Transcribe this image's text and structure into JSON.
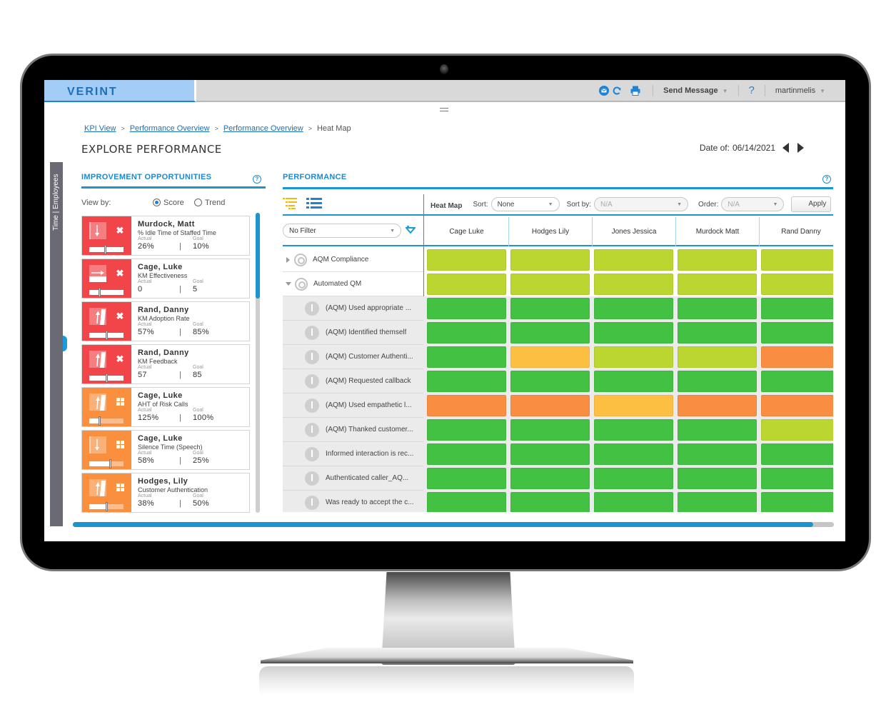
{
  "app": {
    "brand": "VERINT",
    "topbar": {
      "icons": [
        "mail-icon",
        "refresh-icon",
        "print-icon"
      ],
      "send_message": "Send Message",
      "help": "?",
      "username": "martinmelis"
    }
  },
  "breadcrumb": [
    {
      "label": "KPI View",
      "link": true
    },
    {
      "label": "Performance Overview",
      "link": true
    },
    {
      "label": "Performance Overview",
      "link": true
    },
    {
      "label": "Heat Map",
      "link": false
    }
  ],
  "breadcrumb_separator": ">",
  "page_title": "EXPLORE PERFORMANCE",
  "date": {
    "label": "Date of:",
    "value": "06/14/2021"
  },
  "side_tab": "Time | Employees",
  "improvement": {
    "title": "IMPROVEMENT OPPORTUNITIES",
    "view_by_label": "View by:",
    "options": [
      {
        "label": "Score",
        "selected": true
      },
      {
        "label": "Trend",
        "selected": false
      }
    ],
    "actual_label": "Actual",
    "goal_label": "Goal",
    "cards": [
      {
        "name": "Murdock, Matt",
        "kpi": "% Idle Time of Staffed Time",
        "actual": "26%",
        "goal": "10%",
        "status": "red",
        "trend": "down",
        "gauge": 0.45
      },
      {
        "name": "Cage, Luke",
        "kpi": "KM Effectiveness",
        "actual": "0",
        "goal": "5",
        "status": "red",
        "trend": "flat",
        "gauge": 0.3
      },
      {
        "name": "Rand, Danny",
        "kpi": "KM Adoption Rate",
        "actual": "57%",
        "goal": "85%",
        "status": "red",
        "trend": "up",
        "gauge": 0.5
      },
      {
        "name": "Rand, Danny",
        "kpi": "KM Feedback",
        "actual": "57",
        "goal": "85",
        "status": "red",
        "trend": "up",
        "gauge": 0.5
      },
      {
        "name": "Cage, Luke",
        "kpi": "AHT of Risk Calls",
        "actual": "125%",
        "goal": "100%",
        "status": "orange",
        "trend": "up",
        "gauge": 0.3
      },
      {
        "name": "Cage, Luke",
        "kpi": "Silence Time (Speech)",
        "actual": "58%",
        "goal": "25%",
        "status": "orange",
        "trend": "down",
        "gauge": 0.6
      },
      {
        "name": "Hodges, Lily",
        "kpi": "Customer Authentication",
        "actual": "38%",
        "goal": "50%",
        "status": "orange",
        "trend": "up",
        "gauge": 0.5
      }
    ]
  },
  "performance": {
    "title": "PERFORMANCE",
    "heatmap_label": "Heat Map",
    "sort_label": "Sort:",
    "sort_value": "None",
    "sort_by_label": "Sort by:",
    "sort_by_value": "N/A",
    "order_label": "Order:",
    "order_value": "N/A",
    "apply_label": "Apply",
    "filter_value": "No Filter",
    "columns": [
      "Cage Luke",
      "Hodges Lily",
      "Jones Jessica",
      "Murdock Matt",
      "Rand Danny"
    ],
    "rows": [
      {
        "label": "AQM Compliance",
        "type": "group",
        "expanded": false,
        "cells": [
          "lime",
          "lime",
          "lime",
          "lime",
          "lime"
        ]
      },
      {
        "label": "Automated QM",
        "type": "group",
        "expanded": true,
        "cells": [
          "lime",
          "lime",
          "lime",
          "lime",
          "lime"
        ]
      },
      {
        "label": "(AQM) Used appropriate ...",
        "type": "child",
        "cells": [
          "green",
          "green",
          "green",
          "green",
          "green"
        ]
      },
      {
        "label": "(AQM) Identified themself",
        "type": "child",
        "cells": [
          "green",
          "green",
          "green",
          "green",
          "green"
        ]
      },
      {
        "label": "(AQM) Customer Authenti...",
        "type": "child",
        "cells": [
          "green",
          "yellow",
          "lime",
          "lime",
          "orange"
        ]
      },
      {
        "label": "(AQM) Requested callback",
        "type": "child",
        "cells": [
          "green",
          "green",
          "green",
          "green",
          "green"
        ]
      },
      {
        "label": "(AQM) Used empathetic l...",
        "type": "child",
        "cells": [
          "orange",
          "orange",
          "yellow",
          "orange",
          "orange"
        ]
      },
      {
        "label": "(AQM) Thanked customer...",
        "type": "child",
        "cells": [
          "green",
          "green",
          "green",
          "green",
          "lime"
        ]
      },
      {
        "label": "Informed interaction is rec...",
        "type": "child",
        "cells": [
          "green",
          "green",
          "green",
          "green",
          "green"
        ]
      },
      {
        "label": "Authenticated caller_AQ...",
        "type": "child",
        "cells": [
          "green",
          "green",
          "green",
          "green",
          "green"
        ]
      },
      {
        "label": "Was ready to accept the c...",
        "type": "child",
        "cells": [
          "green",
          "green",
          "green",
          "green",
          "green"
        ]
      }
    ],
    "colors": {
      "green": "#42c142",
      "lime": "#bbd630",
      "yellow": "#fdbf41",
      "orange": "#f98d41"
    }
  },
  "accent": "#1b94cf",
  "status_colors": {
    "red": "#f2454a",
    "orange": "#fa8f3e"
  }
}
